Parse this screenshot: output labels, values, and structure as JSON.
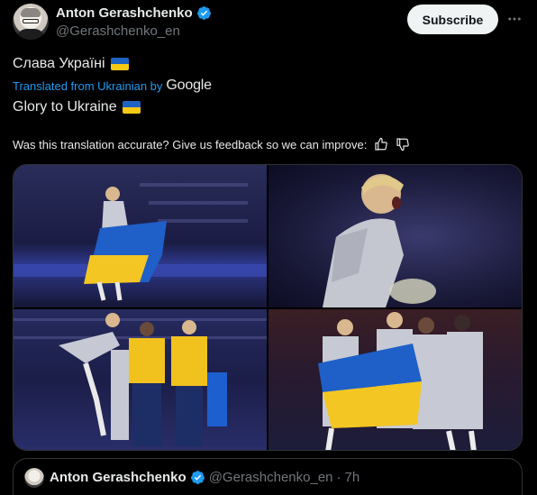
{
  "author": {
    "name": "Anton Gerashchenko",
    "handle": "@Gerashchenko_en"
  },
  "actions": {
    "subscribe_label": "Subscribe",
    "more_icon": "more-horizontal-icon"
  },
  "post": {
    "original_text": "Слава Україні",
    "translated_prefix": "Translated from Ukrainian by",
    "translator": "Google",
    "translated_text": "Glory to Ukraine",
    "feedback_prompt": "Was this translation accurate? Give us feedback so we can improve:"
  },
  "colors": {
    "link": "#1d9bf0",
    "verified": "#1d9bf0",
    "flag_blue": "#1e63c4",
    "flag_yellow": "#f6c915"
  },
  "quoted": {
    "name": "Anton Gerashchenko",
    "handle": "@Gerashchenko_en",
    "separator": "·",
    "time": "7h"
  }
}
